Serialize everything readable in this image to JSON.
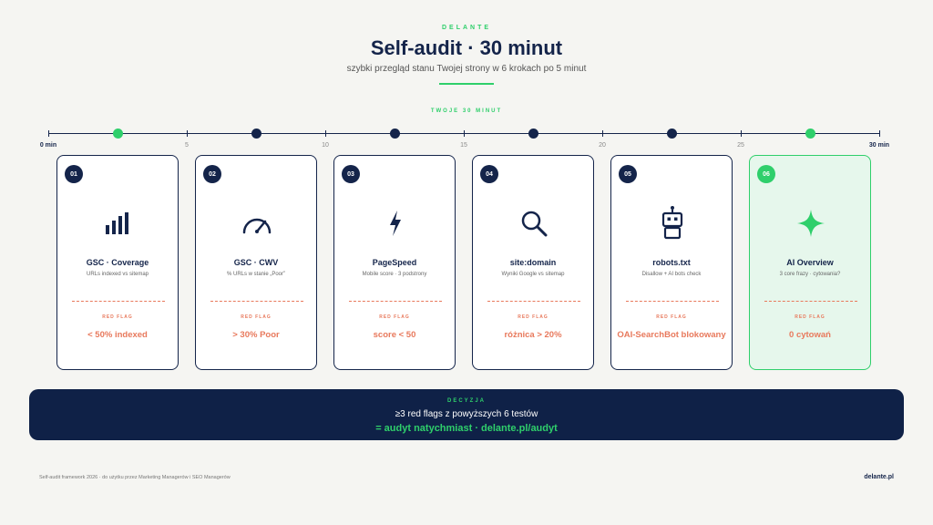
{
  "header": {
    "brand": "DELANTE",
    "title": "Self-audit · 30 minut",
    "subtitle": "szybki przegląd stanu Twojej strony w 6 krokach po 5 minut",
    "section_label": "TWOJE 30 MINUT"
  },
  "timeline": {
    "labels": [
      "0 min",
      "5",
      "10",
      "15",
      "20",
      "25",
      "30 min"
    ]
  },
  "cards": [
    {
      "num": "01",
      "icon": "bar-chart-icon",
      "title": "GSC · Coverage",
      "desc": "URLs indexed vs sitemap",
      "flag_label": "RED FLAG",
      "flag_value": "< 50% indexed"
    },
    {
      "num": "02",
      "icon": "gauge-icon",
      "title": "GSC · CWV",
      "desc": "% URLs w stanie „Poor”",
      "flag_label": "RED FLAG",
      "flag_value": "> 30% Poor"
    },
    {
      "num": "03",
      "icon": "lightning-icon",
      "title": "PageSpeed",
      "desc": "Mobile score · 3 podstrony",
      "flag_label": "RED FLAG",
      "flag_value": "score < 50"
    },
    {
      "num": "04",
      "icon": "search-icon",
      "title": "site:domain",
      "desc": "Wyniki Google vs sitemap",
      "flag_label": "RED FLAG",
      "flag_value": "różnica > 20%"
    },
    {
      "num": "05",
      "icon": "robot-icon",
      "title": "robots.txt",
      "desc": "Disallow + AI bots check",
      "flag_label": "RED FLAG",
      "flag_value": "OAI-SearchBot blokowany"
    },
    {
      "num": "06",
      "icon": "sparkle-icon",
      "title": "AI Overview",
      "desc": "3 core frazy · cytowania?",
      "flag_label": "RED FLAG",
      "flag_value": "0 cytowań"
    }
  ],
  "decision": {
    "label": "DECYZJA",
    "text": "≥3 red flags z powyższych 6 testów",
    "cta": "= audyt natychmiast · delante.pl/audyt"
  },
  "footer": {
    "left": "Self-audit framework 2026 · do użytku przez Marketing Managerów i SEO Managerów",
    "right": "delante.pl"
  },
  "colors": {
    "navy": "#14244a",
    "green": "#2fcf6b",
    "red_flag": "#e8795c",
    "background": "#f5f5f2"
  }
}
